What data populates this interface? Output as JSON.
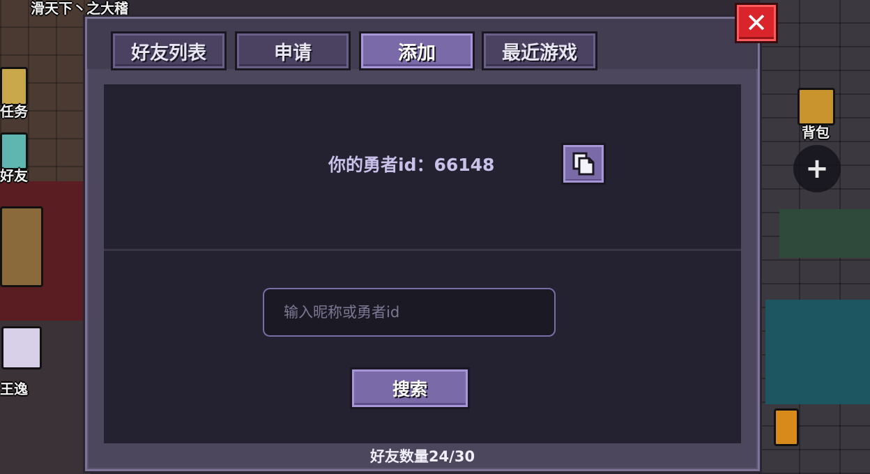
{
  "background": {
    "top_banner_text": "滑天下丶之大稽",
    "left_labels": [
      "任务",
      "好友"
    ],
    "player_name": "王逸",
    "right_label": "背包"
  },
  "dialog": {
    "tabs": [
      {
        "label": "好友列表",
        "active": false
      },
      {
        "label": "申请",
        "active": false
      },
      {
        "label": "添加",
        "active": true
      },
      {
        "label": "最近游戏",
        "active": false
      }
    ],
    "hero_id_label": "你的勇者id：66148",
    "search_placeholder": "输入昵称或勇者id",
    "search_value": "",
    "search_button": "搜索",
    "friend_count": "好友数量24/30"
  },
  "icons": {
    "close": "close-icon",
    "copy": "copy-icon",
    "plus": "plus-icon",
    "backpack": "backpack-icon"
  },
  "colors": {
    "accent": "#7b6aa8",
    "close": "#d8242a",
    "panel": "#242130"
  }
}
